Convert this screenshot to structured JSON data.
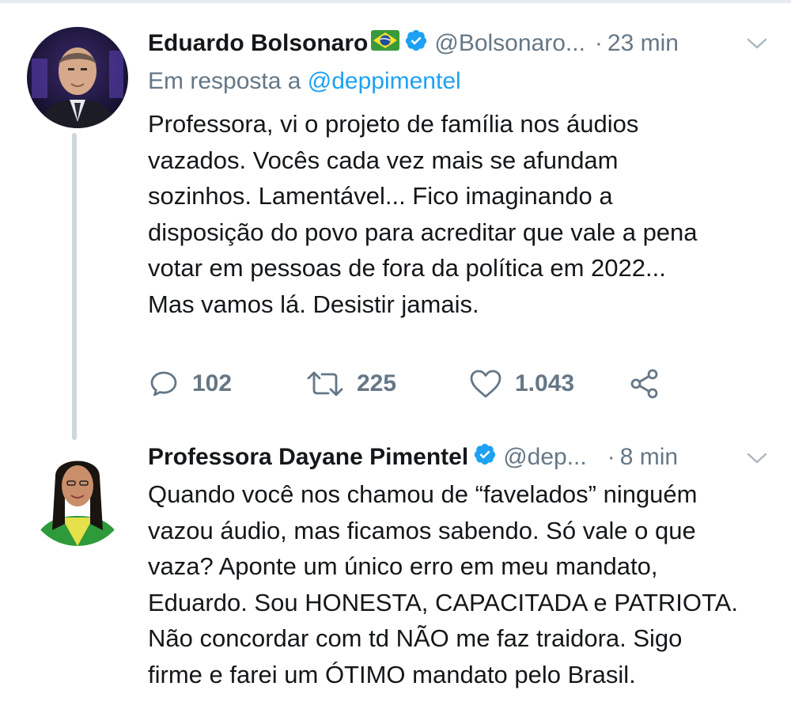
{
  "colors": {
    "text": "#14171a",
    "secondary": "#657786",
    "link": "#1da1f2",
    "verified": "#1da1f2",
    "thread_line": "#ccd6dd"
  },
  "tweet1": {
    "author_name": "Eduardo Bolsonaro",
    "flag_icon": "brazil-flag-icon",
    "handle": "@Bolsonaro...",
    "separator": "·",
    "time": "23 min",
    "reply_prefix": "Em resposta a",
    "reply_handle": "@deppimentel",
    "text_lines": [
      "Professora, vi o projeto de família nos áudios",
      "vazados. Vocês cada vez mais se afundam",
      "sozinhos. Lamentável... Fico imaginando a",
      "disposição do povo para acreditar que vale a pena",
      "votar em pessoas de fora da política em 2022...",
      "Mas vamos lá. Desistir jamais."
    ],
    "replies": "102",
    "retweets": "225",
    "likes": "1.043"
  },
  "tweet2": {
    "author_name": "Professora Dayane Pimentel",
    "handle": "@dep...",
    "separator": "·",
    "time": "8 min",
    "text_lines": [
      "Quando você nos chamou de “favelados” ninguém",
      "vazou áudio, mas ficamos sabendo. Só vale o que",
      "vaza? Aponte um único erro em meu mandato,",
      "Eduardo. Sou HONESTA, CAPACITADA e PATRIOTA.",
      "Não concordar com td NÃO me faz traidora. Sigo",
      "firme e farei um ÓTIMO mandato pelo Brasil."
    ]
  }
}
